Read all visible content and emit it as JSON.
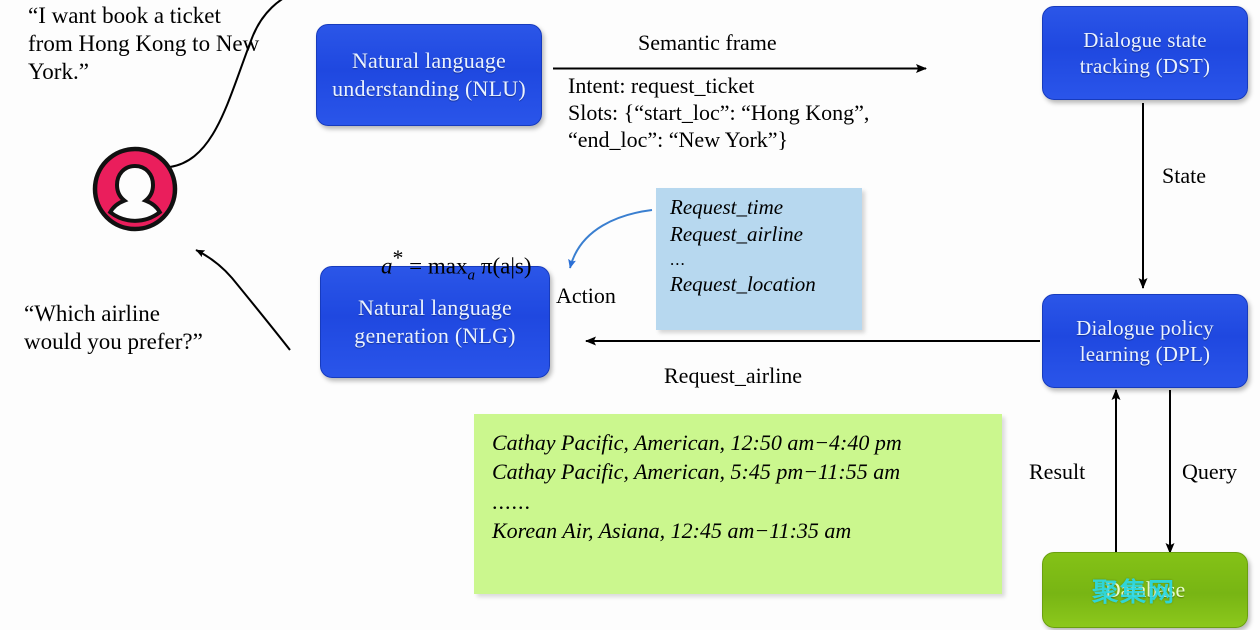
{
  "user": {
    "avatar_icon": "person-avatar-icon",
    "utterance_in": "“I want book a ticket\nfrom Hong Kong to New\nYork.”",
    "utterance_out": "“Which airline\nwould you prefer?”"
  },
  "modules": {
    "nlu": "Natural language\nunderstanding\n(NLU)",
    "dst": "Dialogue state\ntracking (DST)",
    "dpl": "Dialogue policy\nlearning (DPL)",
    "nlg": "Natural\nlanguage\ngeneration (NLG)",
    "database": "Database"
  },
  "watermark": "聚集网",
  "edges": {
    "semantic_frame_label": "Semantic frame",
    "semantic_frame_detail": "Intent: request_ticket\nSlots: {“start_loc”: “Hong Kong”,\n“end_loc”: “New York”}",
    "state_label": "State",
    "action_label": "Action",
    "request_airline_label": "Request_airline",
    "result_label": "Result",
    "query_label": "Query"
  },
  "policy_formula": {
    "lhs": "a",
    "star": "*",
    "eq": " = max",
    "sub": "a",
    "rhs": " π(a|s)"
  },
  "action_list": {
    "items": [
      "Request_time",
      "Request_airline",
      "...",
      "Request_location"
    ]
  },
  "db_results": {
    "rows": [
      "Cathay Pacific, American, 12:50 am−4:40 pm",
      "Cathay Pacific, American, 5:45 pm−11:55 am",
      "......",
      "Korean Air, Asiana, 12:45 am−11:35 am"
    ]
  },
  "colors": {
    "module_blue": "#2348e4",
    "database_green": "#7cb816",
    "action_panel_blue": "#b7d8ef",
    "result_panel_green": "#cbf78e",
    "avatar_pink": "#ea1e5c",
    "watermark_cyan": "#2ad8e8"
  }
}
